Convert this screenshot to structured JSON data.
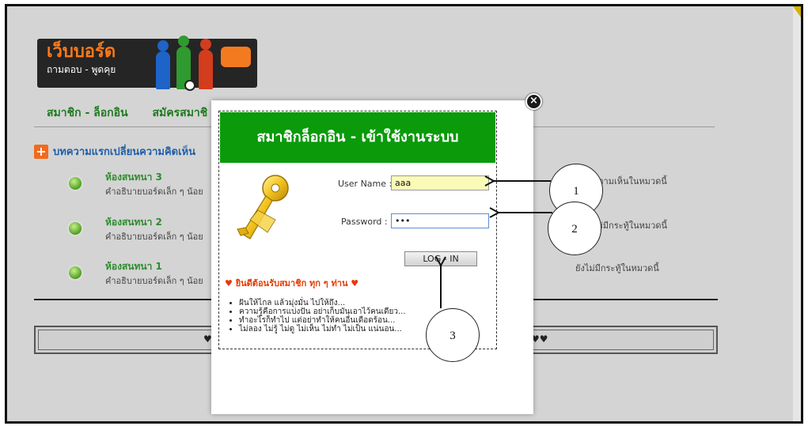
{
  "logo": {
    "title": "เว็บบอร์ด",
    "subtitle": "ถามตอบ - พูดคุย"
  },
  "nav": {
    "login": "สมาชิก - ล็อกอิน",
    "register": "สมัครสมาชิ"
  },
  "section": {
    "title": "บทความแรกเปลี่ยนความคิดเห็น"
  },
  "rooms": [
    {
      "name": "ห้องสนทนา 3",
      "desc": "คำอธิบายบอร์ดเล็ก ๆ น้อย",
      "note": "ความเห็นในหมวดนี้"
    },
    {
      "name": "ห้องสนทนา 2",
      "desc": "คำอธิบายบอร์ดเล็ก ๆ น้อย",
      "note": "ไม่มีกระทู้ในหมวดนี้"
    },
    {
      "name": "ห้องสนทนา 1",
      "desc": "คำอธิบายบอร์ดเล็ก ๆ น้อย",
      "note": "ยังไม่มีกระทู้ในหมวดนี้"
    }
  ],
  "footer": {
    "left": "♥♥",
    "right": "♥♥"
  },
  "modal": {
    "title": "สมาชิกล็อกอิน - เข้าใช้งานระบบ",
    "username_label": "User Name :",
    "username_value": "aaa",
    "password_label": "Password :",
    "password_value": "•••",
    "login_button": "LOG - IN",
    "close": "×",
    "welcome": "♥ ยินดีต้อนรับสมาชิก ทุก ๆ ท่าน ♥",
    "bullets": [
      "ฝันให้ไกล แล้วมุ่งมั่น ไปให้ถึง...",
      "ความรู้คือการแบ่งปัน อย่าเก็บมันเอาไว้คนเดียว...",
      "ทำอะไรก็ทำไป แต่อย่าทำให้คนอื่นเดือดร้อน...",
      "ไม่ลอง ไม่รู้ ไม่ดู ไม่เห็น ไม่ทำ ไม่เป็น แน่นอน..."
    ]
  },
  "callouts": {
    "c1": "1",
    "c2": "2",
    "c3": "3"
  },
  "colors": {
    "header_green": "#0a9a0a",
    "accent_orange": "#f26a1b",
    "room_green": "#2e8b2e"
  },
  "icons": {
    "key": "key-icon",
    "plus": "plus-icon",
    "room": "room-dot-icon",
    "close": "close-icon"
  }
}
